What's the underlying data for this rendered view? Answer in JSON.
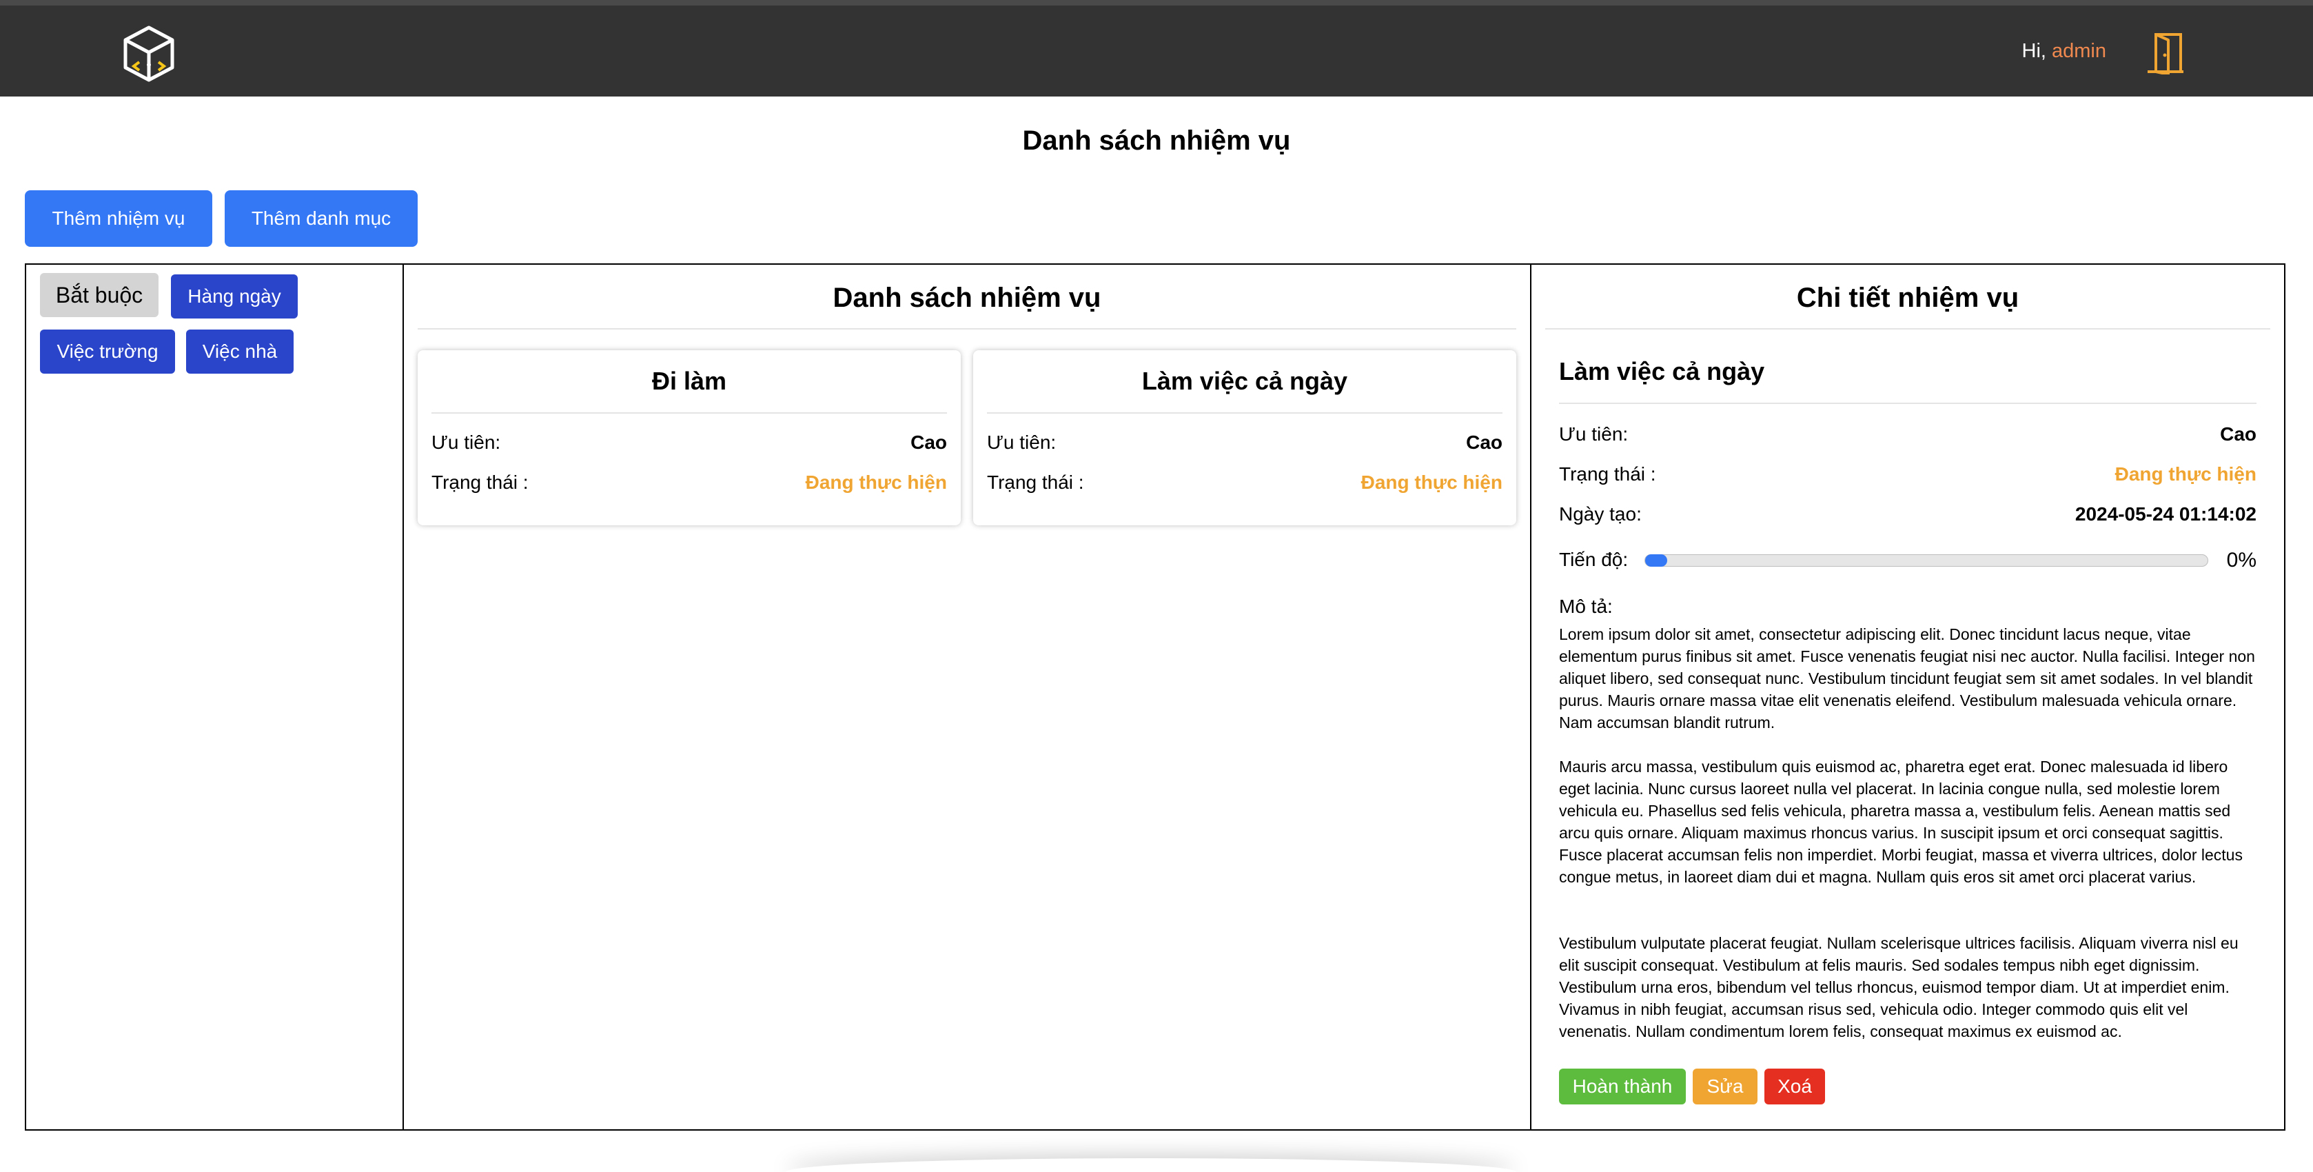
{
  "header": {
    "logo_icon": "cube-logo-icon",
    "greeting_prefix": "Hi, ",
    "username": "admin",
    "logout_icon": "door-exit-icon",
    "accent_color": "#f0894f"
  },
  "page": {
    "title": "Danh sách nhiệm vụ"
  },
  "toolbar": {
    "add_task_label": "Thêm nhiệm vụ",
    "add_category_label": "Thêm danh mục"
  },
  "categories": [
    {
      "label": "Bắt buộc",
      "active": true
    },
    {
      "label": "Hàng ngày",
      "active": false
    },
    {
      "label": "Việc trường",
      "active": false
    },
    {
      "label": "Việc nhà",
      "active": false
    }
  ],
  "task_list": {
    "title": "Danh sách nhiệm vụ",
    "cards": [
      {
        "title": "Đi làm",
        "priority_label": "Ưu tiên:",
        "priority": "Cao",
        "status_label": "Trạng thái :",
        "status": "Đang thực hiện"
      },
      {
        "title": "Làm việc cả ngày",
        "priority_label": "Ưu tiên:",
        "priority": "Cao",
        "status_label": "Trạng thái :",
        "status": "Đang thực hiện"
      }
    ]
  },
  "detail": {
    "panel_title": "Chi tiết nhiệm vụ",
    "name": "Làm việc cả ngày",
    "priority_label": "Ưu tiên:",
    "priority": "Cao",
    "status_label": "Trạng thái :",
    "status": "Đang thực hiện",
    "created_label": "Ngày tạo:",
    "created": "2024-05-24 01:14:02",
    "progress_label": "Tiến độ:",
    "progress_value": 0,
    "progress_text": "0%",
    "description_label": "Mô tả:",
    "description": [
      "Lorem ipsum dolor sit amet, consectetur adipiscing elit. Donec tincidunt lacus neque, vitae elementum purus finibus sit amet. Fusce venenatis feugiat nisi nec auctor. Nulla facilisi. Integer non aliquet libero, sed consequat nunc. Vestibulum tincidunt feugiat sem sit amet sodales. In vel blandit purus. Mauris ornare massa vitae elit venenatis eleifend. Vestibulum malesuada vehicula ornare. Nam accumsan blandit rutrum.",
      "Mauris arcu massa, vestibulum quis euismod ac, pharetra eget erat. Donec malesuada id libero eget lacinia. Nunc cursus laoreet nulla vel placerat. In lacinia congue nulla, sed molestie lorem vehicula eu. Phasellus sed felis vehicula, pharetra massa a, vestibulum felis. Aenean mattis sed arcu quis ornare. Aliquam maximus rhoncus varius. In suscipit ipsum et orci consequat sagittis. Fusce placerat accumsan felis non imperdiet. Morbi feugiat, massa et viverra ultrices, dolor lectus congue metus, in laoreet diam dui et magna. Nullam quis eros sit amet orci placerat varius.",
      "Vestibulum vulputate placerat feugiat. Nullam scelerisque ultrices facilisis. Aliquam viverra nisl eu elit suscipit consequat. Vestibulum at felis mauris. Sed sodales tempus nibh eget dignissim. Vestibulum urna eros, bibendum vel tellus rhoncus, euismod tempor diam. Ut at imperdiet enim. Vivamus in nibh feugiat, accumsan risus sed, vehicula odio. Integer commodo quis elit vel venenatis. Nullam condimentum lorem felis, consequat maximus ex euismod ac."
    ],
    "actions": {
      "complete_label": "Hoàn thành",
      "edit_label": "Sửa",
      "delete_label": "Xoá"
    }
  },
  "colors": {
    "primary": "#3478f6",
    "category": "#2a45c9",
    "status": "#f0a532",
    "complete": "#5dbb3e",
    "edit": "#f0a532",
    "delete": "#e53021"
  }
}
